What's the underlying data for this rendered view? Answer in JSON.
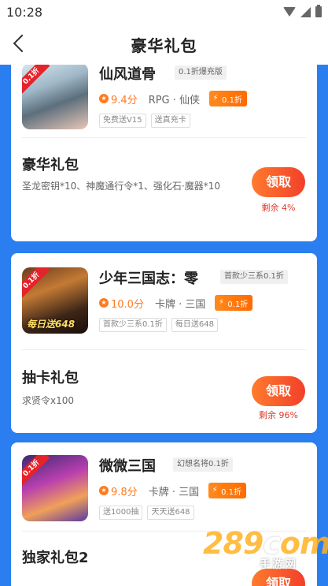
{
  "status_bar": {
    "time": "10:28"
  },
  "header": {
    "title": "豪华礼包"
  },
  "games": [
    {
      "name": "仙风道骨",
      "name_tag": "0.1折爆充版",
      "ribbon": "0.1折",
      "icon_caption": "",
      "score": "9.4分",
      "genre": "RPG · 仙侠",
      "discount": "0.1折",
      "tags": [
        "免费送V15",
        "送真充卡"
      ],
      "gift_title": "豪华礼包",
      "gift_desc": "圣龙密钥*10、神魔通行令*1、强化石·魔器*10",
      "claim": "领取",
      "remaining": "剩余 4%"
    },
    {
      "name": "少年三国志：零",
      "name_tag": "首款少三系0.1折",
      "ribbon": "0.1折",
      "icon_caption": "每日送648",
      "score": "10.0分",
      "genre": "卡牌 · 三国",
      "discount": "0.1折",
      "tags": [
        "首款少三系0.1折",
        "每日送648"
      ],
      "gift_title": "抽卡礼包",
      "gift_desc": "求贤令x100",
      "claim": "领取",
      "remaining": "剩余 96%"
    },
    {
      "name": "微微三国",
      "name_tag": "幻想名将0.1折",
      "ribbon": "0.1折",
      "icon_caption": "",
      "score": "9.8分",
      "genre": "卡牌 · 三国",
      "discount": "0.1折",
      "tags": [
        "送1000抽",
        "天天送648"
      ],
      "gift_title": "独家礼包2",
      "gift_desc": "",
      "claim": "领取",
      "remaining": ""
    }
  ],
  "watermark": {
    "main": "289",
    "c": "c",
    "rest": "om",
    "sub": "手游网"
  }
}
